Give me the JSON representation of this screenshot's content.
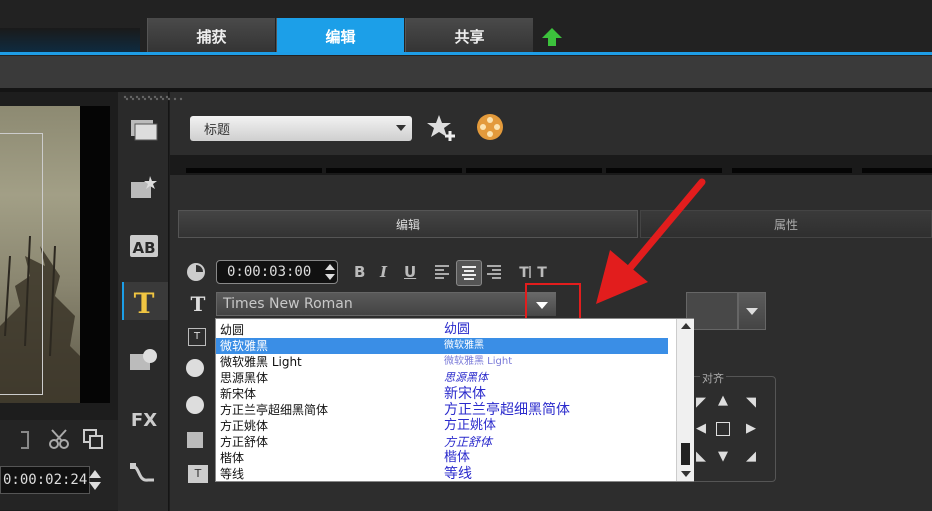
{
  "tabs": [
    {
      "label": "捕获",
      "active": false
    },
    {
      "label": "编辑",
      "active": true
    },
    {
      "label": "共享",
      "active": false
    }
  ],
  "preview": {
    "timecode": "0:00:02:24"
  },
  "library": {
    "category_value": "标题"
  },
  "subtabs": {
    "edit": "编辑",
    "attributes": "属性"
  },
  "text_options": {
    "duration": "0:00:03:00",
    "bold": "B",
    "italic": "I",
    "underline": "U",
    "font_current": "Times New Roman",
    "align_group_label": "对齐"
  },
  "font_list": [
    {
      "name": "幼圆",
      "preview": "幼圆"
    },
    {
      "name": "微软雅黑",
      "preview": "微软雅黑",
      "selected": true
    },
    {
      "name": "微软雅黑 Light",
      "preview": "微软雅黑 Light"
    },
    {
      "name": "思源黑体",
      "preview": "思源黑体"
    },
    {
      "name": "新宋体",
      "preview": "新宋体"
    },
    {
      "name": "方正兰亭超细黑简体",
      "preview": "方正兰亭超细黑简体"
    },
    {
      "name": "方正姚体",
      "preview": "方正姚体"
    },
    {
      "name": "方正舒体",
      "preview": "方正舒体"
    },
    {
      "name": "楷体",
      "preview": "楷体"
    },
    {
      "name": "等线",
      "preview": "等线"
    }
  ],
  "colors": {
    "accent": "#1c9fe8",
    "highlight": "#e21d1d",
    "selection": "#3a8ee6"
  }
}
